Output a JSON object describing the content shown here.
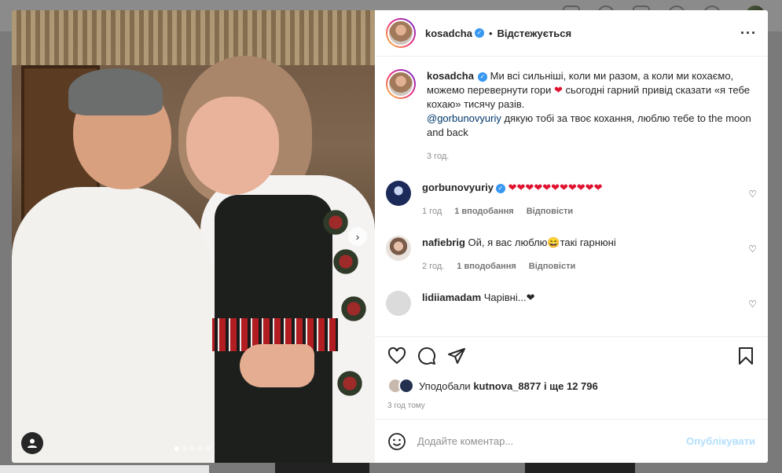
{
  "post": {
    "author": "kosadcha",
    "follow_status": "Відстежується",
    "caption_text": "Ми всі сильніші, коли ми разом, а коли ми кохаємо, можемо перевернути гори",
    "caption_heart": "❤",
    "caption_rest": " сьогодні гарний привід сказати «я тебе кохаю» тисячу разів.",
    "caption_mention": "@gorbunovyuriy",
    "caption_tail": " дякую тобі за твоє кохання, люблю тебе to the moon and back",
    "caption_time": "3 год."
  },
  "comments": [
    {
      "username": "gorbunovyuriy",
      "verified": true,
      "text": "❤❤❤❤❤❤❤❤❤❤❤",
      "time": "1 год",
      "likes": "1 вподобання",
      "reply": "Відповісти",
      "avatar_color": "#1c2a5a"
    },
    {
      "username": "nafiebrig",
      "verified": false,
      "text": "Ой, я вас люблю😄такі гарнюні",
      "time": "2 год.",
      "likes": "1 вподобання",
      "reply": "Відповісти",
      "avatar_color": "#d8c2b0"
    },
    {
      "username": "lidiiamadam",
      "verified": false,
      "text": "Чарівні...❤",
      "avatar_color": "#dbdbdb"
    }
  ],
  "likes": {
    "prefix": "Уподобали",
    "user": "kutnova_8877",
    "suffix": "і ще 12 796"
  },
  "timestamp": "3 год тому",
  "add_comment": {
    "placeholder": "Додайте коментар...",
    "publish": "Опублікувати"
  },
  "colors": {
    "accent": "#0095f6",
    "heart": "#e0102e",
    "verified": "#3897f0",
    "publish_disabled": "#b2dffc"
  },
  "icons": {
    "like": "heart-outline-icon",
    "comment": "comment-bubble-icon",
    "share": "paper-plane-icon",
    "save": "bookmark-icon",
    "emoji": "smiley-icon",
    "more": "ellipsis-icon",
    "next": "chevron-right-icon",
    "tags": "user-tag-icon"
  },
  "carousel": {
    "slide_count": 5,
    "active_slide": 1
  }
}
